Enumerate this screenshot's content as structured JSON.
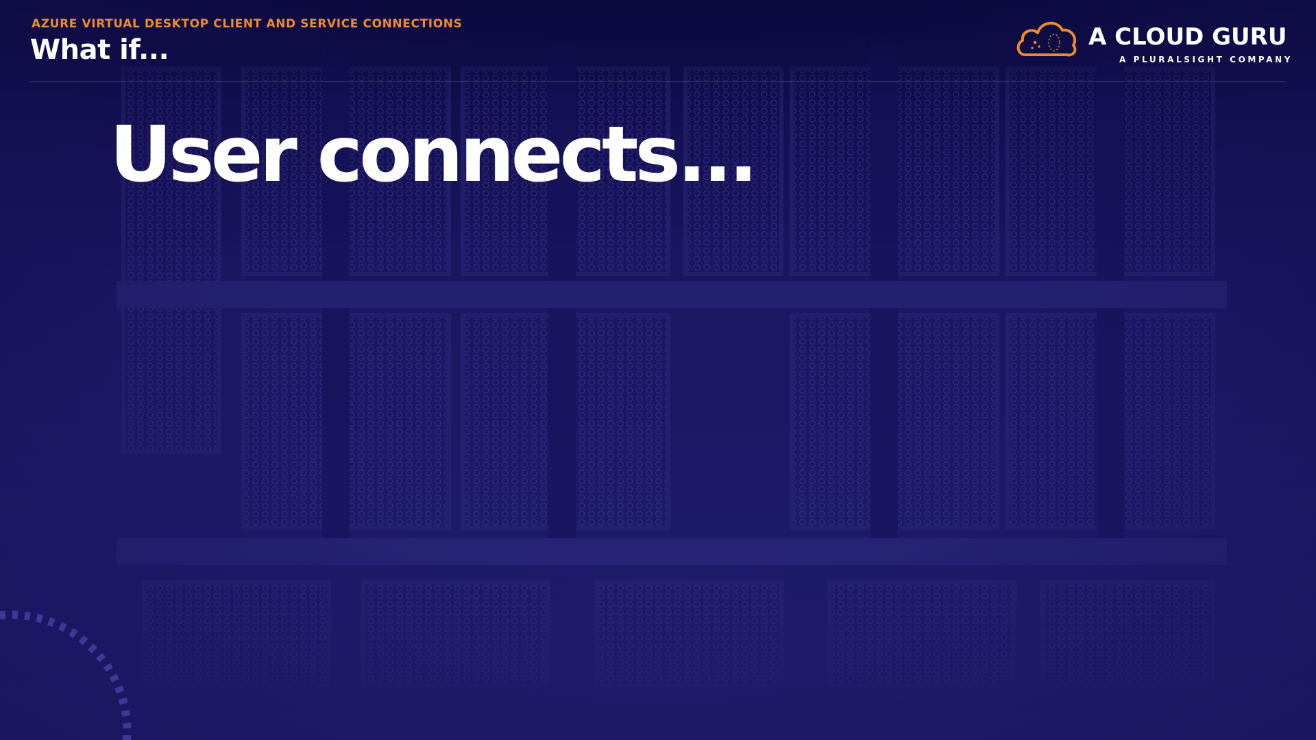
{
  "slide": {
    "section_label": "AZURE VIRTUAL DESKTOP CLIENT AND SERVICE CONNECTIONS",
    "title": "What if...",
    "headline": "User connects..."
  },
  "brand": {
    "name": "A CLOUD GURU",
    "tagline": "A PLURALSIGHT COMPANY",
    "logo_icon": "cloud-icon"
  },
  "colors": {
    "accent": "#ef8a2c",
    "background": "#1c1760",
    "text": "#ffffff"
  }
}
